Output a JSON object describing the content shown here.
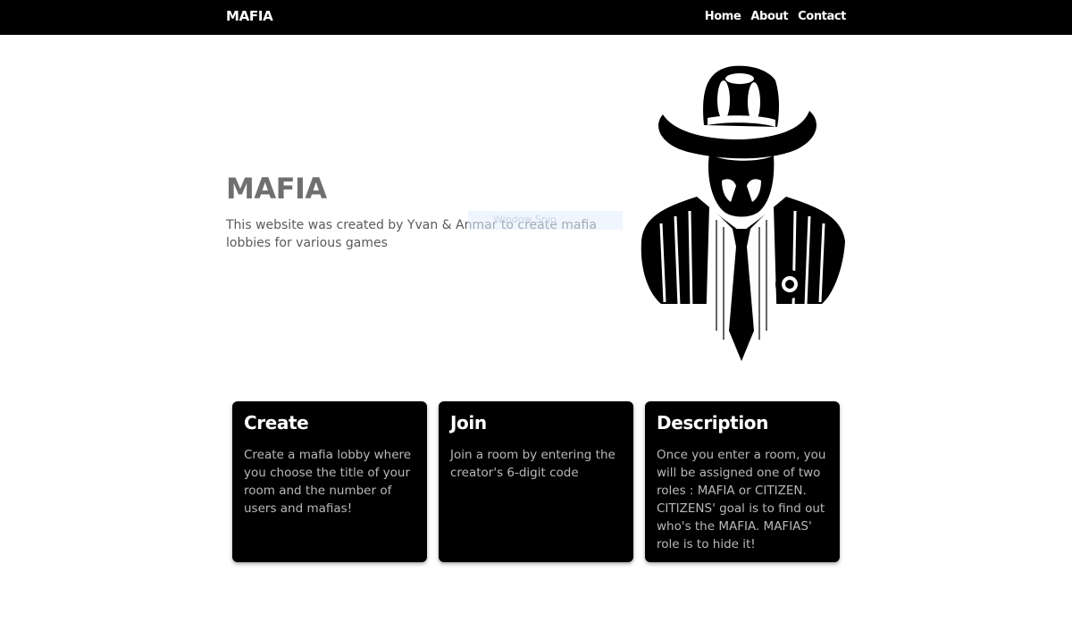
{
  "navbar": {
    "brand": "MAFIA",
    "links": [
      "Home",
      "About",
      "Contact"
    ]
  },
  "hero": {
    "title": "MAFIA",
    "text": "This website was created by Yvan & Anmar to create mafia lobbies for various games",
    "overlay": "Window Snip"
  },
  "cards": [
    {
      "title": "Create",
      "text": "Create a mafia lobby where you choose the title of your room and the number of users and mafias!"
    },
    {
      "title": "Join",
      "text": "Join a room by entering the creator's 6-digit code"
    },
    {
      "title": "Description",
      "text": "Once you enter a room, you will be assigned one of two roles : MAFIA or CITIZEN. CITIZENS' goal is to find out who's the MAFIA. MAFIAS' role is to hide it!"
    }
  ],
  "colors": {
    "navbar_bg": "#000000",
    "card_bg": "#000000",
    "title_gray": "#6f6f6f"
  }
}
